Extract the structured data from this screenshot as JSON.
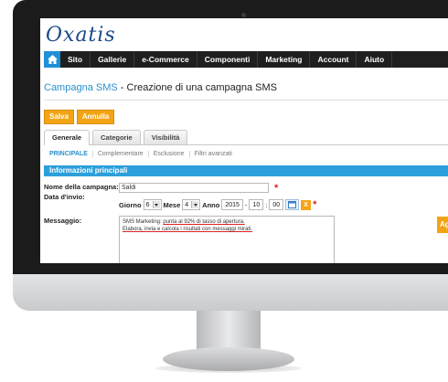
{
  "app": {
    "logo": "Oxatis"
  },
  "nav": {
    "items": [
      "Sito",
      "Gallerie",
      "e-Commerce",
      "Componenti",
      "Marketing",
      "Account",
      "Aiuto"
    ]
  },
  "page": {
    "title_link": "Campagna SMS",
    "title_rest": " - Creazione di una campagna SMS"
  },
  "actions": {
    "save": "Salva",
    "cancel": "Annulla"
  },
  "tabs": [
    "Generale",
    "Categorie",
    "Visibilità"
  ],
  "subtabs": [
    "PRINCIPALE",
    "Complementare",
    "Esclusione",
    "Filtri avanzati"
  ],
  "section": {
    "title": "Informazioni principali"
  },
  "form": {
    "campaign_name_label": "Nome della campagna:",
    "campaign_name_value": "Saldi",
    "send_date_label": "Data d'invio:",
    "day_label": "Giorno",
    "day_value": "6",
    "month_label": "Mese",
    "month_value": "4",
    "year_label": "Anno",
    "year_value": "2015",
    "date_sep": "-",
    "hour_value": "10",
    "time_sep": ":",
    "minute_value": "00",
    "clear_label": "X",
    "required_mark": "*",
    "message_label": "Messaggio:",
    "message_line1_a": "SMS Marketing: ",
    "message_line1_b": "punta al 92% di tasso di apertura.",
    "message_line2_a": "Elabora, invia e calcola i risultati con ",
    "message_line2_b": "messaggi mirati."
  },
  "side": {
    "button_label": "Ag"
  },
  "colors": {
    "accent_orange": "#f3a415",
    "accent_blue": "#2c9fdb",
    "link_blue": "#2a91cf",
    "nav_dark": "#1f1f1f",
    "required_red": "#e02020"
  }
}
